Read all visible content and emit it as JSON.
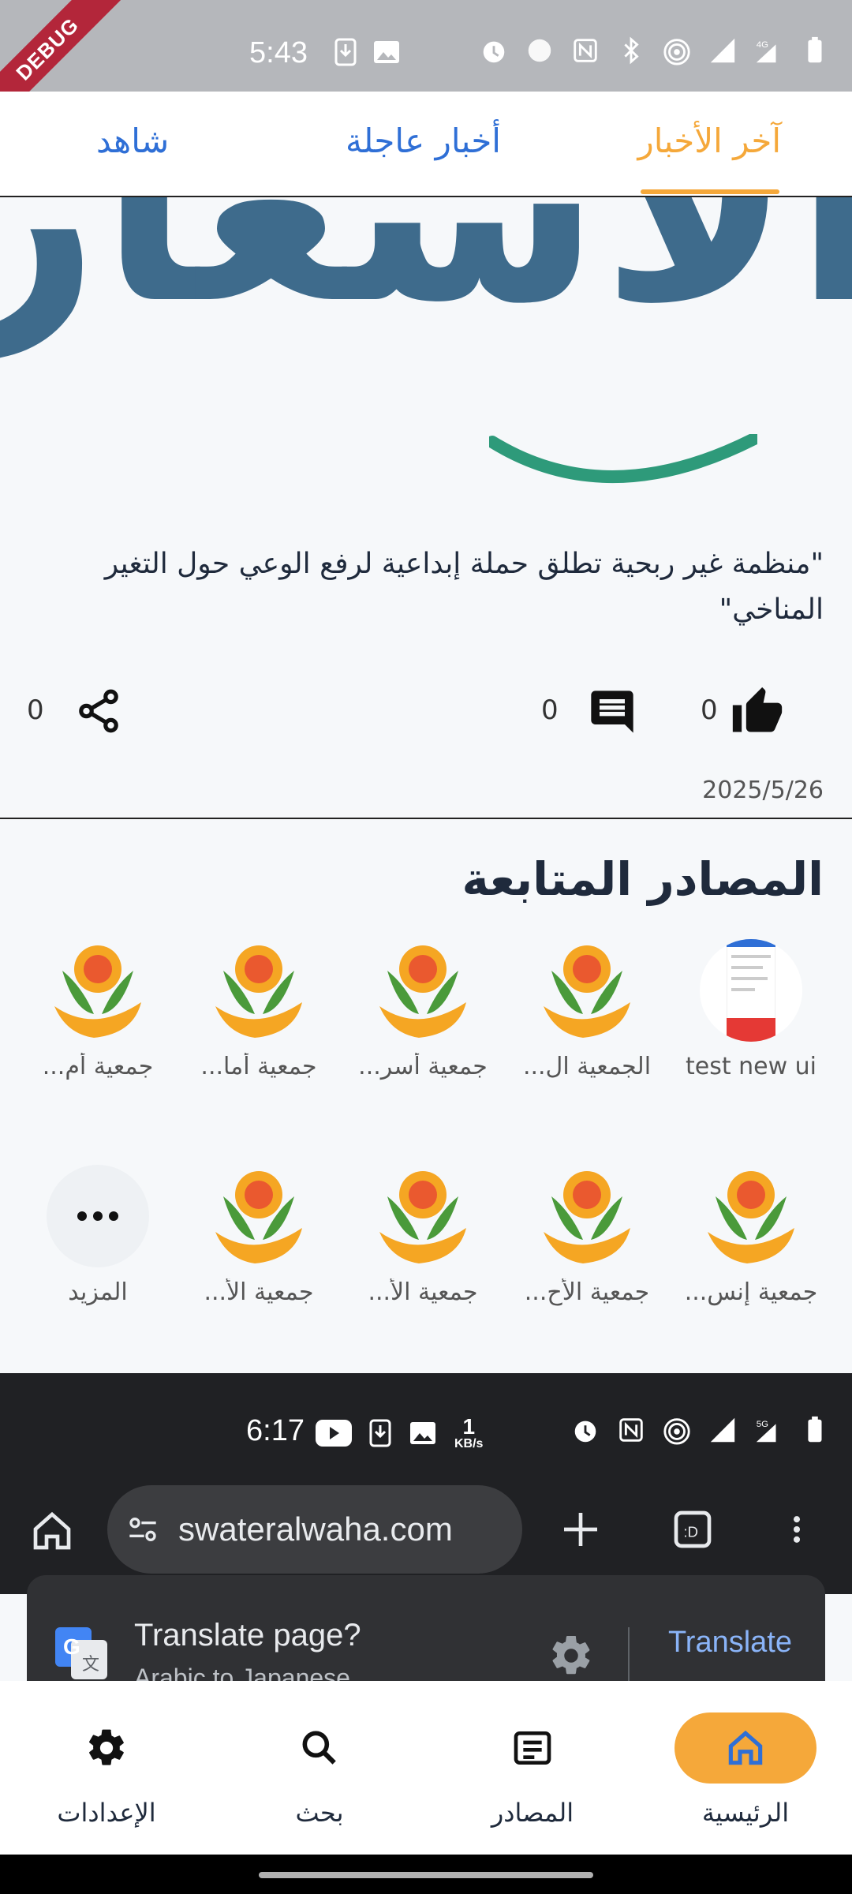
{
  "debug_banner": "DEBUG",
  "status_bar": {
    "time": "5:43",
    "network": "4G"
  },
  "tabs": [
    {
      "label": "آخر الأخبار",
      "active": true
    },
    {
      "label": "أخبار عاجلة",
      "active": false
    },
    {
      "label": "شاهد",
      "active": false
    }
  ],
  "article": {
    "hero_text": "الأسعار",
    "headline": "\"منظمة غير ربحية تطلق حملة إبداعية لرفع الوعي حول التغير المناخي\"",
    "likes": "0",
    "comments": "0",
    "shares": "0",
    "date": "2025/5/26"
  },
  "sources": {
    "title": "المصادر المتابعة",
    "row1": [
      "test new ui",
      "الجمعية ال...",
      "جمعية أسر...",
      "جمعية أما...",
      "جمعية أم..."
    ],
    "row2": [
      "جمعية إنس...",
      "جمعية الأح...",
      "جمعية الأ...",
      "جمعية الأ...",
      "المزيد"
    ]
  },
  "overlay": {
    "time": "6:17",
    "speed_value": "1",
    "speed_unit": "KB/s",
    "network": "5G",
    "url": "swateralwaha.com",
    "translate_title": "Translate page?",
    "translate_sub": "Arabic to Japanese",
    "translate_button": "Translate"
  },
  "bottom_nav": [
    {
      "label": "الرئيسية",
      "icon": "home-icon",
      "active": true
    },
    {
      "label": "المصادر",
      "icon": "article-icon",
      "active": false
    },
    {
      "label": "بحث",
      "icon": "search-icon",
      "active": false
    },
    {
      "label": "الإعدادات",
      "icon": "settings-icon",
      "active": false
    }
  ],
  "colors": {
    "accent": "#f5a83a",
    "tab_blue": "#2f6fd6",
    "text_dark": "#1f2a3c",
    "hero_blue": "#3e6b8c",
    "hero_green": "#2e9a7a"
  }
}
